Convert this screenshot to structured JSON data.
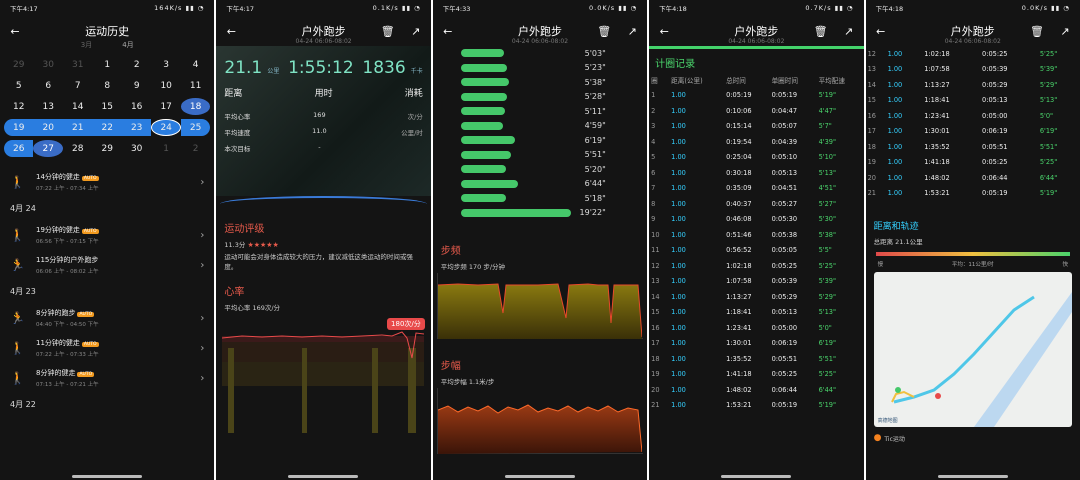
{
  "screen1": {
    "status_time": "下午4:17",
    "status_speed": "164K/s",
    "title": "运动历史",
    "months": [
      "3月",
      "4月"
    ],
    "calendar": [
      [
        "29",
        "30",
        "31",
        "1",
        "2",
        "3",
        "4"
      ],
      [
        "5",
        "6",
        "7",
        "8",
        "9",
        "10",
        "11"
      ],
      [
        "12",
        "13",
        "14",
        "15",
        "16",
        "17",
        "18"
      ],
      [
        "19",
        "20",
        "21",
        "22",
        "23",
        "24",
        "25"
      ],
      [
        "26",
        "27",
        "28",
        "29",
        "30",
        "1",
        "2"
      ]
    ],
    "items": [
      {
        "day": "",
        "title": "14分钟的健走",
        "badge": "AUTO",
        "time": "07:22 上午 - 07:34 上午"
      },
      {
        "day": "4月 24",
        "title": "19分钟的健走",
        "badge": "AUTO",
        "time": "06:56 下午 - 07:15 下午"
      },
      {
        "day": "",
        "title": "115分钟的户外跑步",
        "badge": "",
        "time": "06:06 上午 - 08:02 上午"
      },
      {
        "day": "4月 23",
        "title": "8分钟的跑步",
        "badge": "AUTO",
        "time": "04:40 下午 - 04:50 下午"
      },
      {
        "day": "",
        "title": "11分钟的健走",
        "badge": "AUTO",
        "time": "07:22 上午 - 07:33 上午"
      },
      {
        "day": "",
        "title": "8分钟的健走",
        "badge": "AUTO",
        "time": "07:13 上午 - 07:21 上午"
      },
      {
        "day": "4月 22",
        "title": "",
        "badge": "",
        "time": ""
      }
    ]
  },
  "screen2": {
    "status_time": "下午4:17",
    "status_speed": "0.1K/s",
    "title": "户外跑步",
    "subtitle": "04-24 06:06-08:02",
    "distance": "21.1",
    "distance_unit": "公里",
    "duration": "1:55:12",
    "calories": "1836",
    "calories_unit": "千卡",
    "label_distance": "距离",
    "label_duration": "用时",
    "label_calories": "消耗",
    "avg_hr_label": "平均心率",
    "avg_hr": "169",
    "avg_hr_unit": "次/分",
    "avg_speed_label": "平均速度",
    "avg_speed": "11.0",
    "avg_speed_unit": "公里/时",
    "goal_label": "本次目标",
    "goal": "-",
    "rating_title": "运动评级",
    "rating_score": "11.3分",
    "rating_text": "运动可能会对身体造成较大的压力，建议减低这类运动的时间或强度。",
    "hr_title": "心率",
    "hr_avg": "平均心率 169次/分",
    "hr_peak": "180次/分"
  },
  "screen3": {
    "status_time": "下午4:33",
    "status_speed": "0.0K/s",
    "title": "户外跑步",
    "subtitle": "04-24 06:06-08:02",
    "paces": [
      "5'03\"",
      "5'23\"",
      "5'38\"",
      "5'28\"",
      "5'11\"",
      "4'59\"",
      "6'19\"",
      "5'51\"",
      "5'20\"",
      "6'44\"",
      "5'18\"",
      "19'22\""
    ],
    "cadence_title": "步频",
    "cadence_avg": "平均步频 170 步/分钟",
    "stride_title": "步幅",
    "stride_avg": "平均步幅 1.1米/步"
  },
  "screen4": {
    "status_time": "下午4:18",
    "status_speed": "0.7K/s",
    "title": "户外跑步",
    "subtitle": "04-24 06:06-08:02",
    "section": "计圈记录",
    "headers": [
      "圈",
      "距离(公里)",
      "总时间",
      "单圈时间",
      "平均配速"
    ],
    "laps": [
      [
        "1",
        "1.00",
        "0:05:19",
        "0:05:19",
        "5'19\""
      ],
      [
        "2",
        "1.00",
        "0:10:06",
        "0:04:47",
        "4'47\""
      ],
      [
        "3",
        "1.00",
        "0:15:14",
        "0:05:07",
        "5'7\""
      ],
      [
        "4",
        "1.00",
        "0:19:54",
        "0:04:39",
        "4'39\""
      ],
      [
        "5",
        "1.00",
        "0:25:04",
        "0:05:10",
        "5'10\""
      ],
      [
        "6",
        "1.00",
        "0:30:18",
        "0:05:13",
        "5'13\""
      ],
      [
        "7",
        "1.00",
        "0:35:09",
        "0:04:51",
        "4'51\""
      ],
      [
        "8",
        "1.00",
        "0:40:37",
        "0:05:27",
        "5'27\""
      ],
      [
        "9",
        "1.00",
        "0:46:08",
        "0:05:30",
        "5'30\""
      ],
      [
        "10",
        "1.00",
        "0:51:46",
        "0:05:38",
        "5'38\""
      ],
      [
        "11",
        "1.00",
        "0:56:52",
        "0:05:05",
        "5'5\""
      ],
      [
        "12",
        "1.00",
        "1:02:18",
        "0:05:25",
        "5'25\""
      ],
      [
        "13",
        "1.00",
        "1:07:58",
        "0:05:39",
        "5'39\""
      ],
      [
        "14",
        "1.00",
        "1:13:27",
        "0:05:29",
        "5'29\""
      ],
      [
        "15",
        "1.00",
        "1:18:41",
        "0:05:13",
        "5'13\""
      ],
      [
        "16",
        "1.00",
        "1:23:41",
        "0:05:00",
        "5'0\""
      ],
      [
        "17",
        "1.00",
        "1:30:01",
        "0:06:19",
        "6'19\""
      ],
      [
        "18",
        "1.00",
        "1:35:52",
        "0:05:51",
        "5'51\""
      ],
      [
        "19",
        "1.00",
        "1:41:18",
        "0:05:25",
        "5'25\""
      ],
      [
        "20",
        "1.00",
        "1:48:02",
        "0:06:44",
        "6'44\""
      ],
      [
        "21",
        "1.00",
        "1:53:21",
        "0:05:19",
        "5'19\""
      ]
    ]
  },
  "screen5": {
    "status_time": "下午4:18",
    "status_speed": "0.0K/s",
    "title": "户外跑步",
    "subtitle": "04-24 06:06-08:02",
    "track_title": "距离和轨迹",
    "total_distance": "总距离 21.1公里",
    "legend_slow": "慢",
    "legend_avg": "平均：11公里/时",
    "legend_fast": "快",
    "map_brand": "高德地图",
    "app_name": "Tic运动"
  }
}
